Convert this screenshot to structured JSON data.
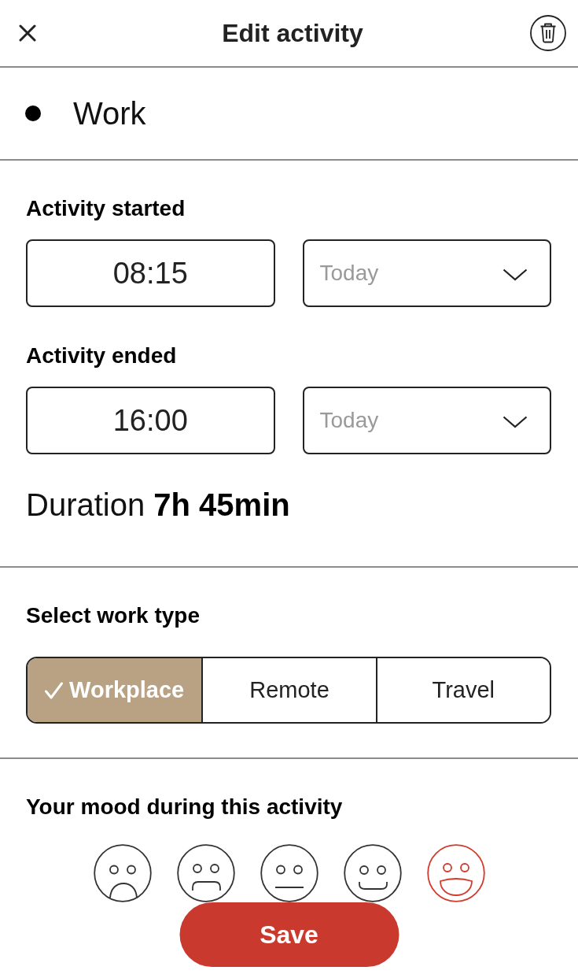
{
  "header": {
    "title": "Edit activity"
  },
  "activity": {
    "name": "Work"
  },
  "times": [
    {
      "label": "Activity started",
      "time": {
        "value": "08:15"
      },
      "day": {
        "placeholder": "Today"
      }
    },
    {
      "label": "Activity ended",
      "time": {
        "value": "16:00"
      },
      "day": {
        "placeholder": "Today"
      }
    }
  ],
  "duration": "Duration **7h 45min**",
  "work_type": {
    "label": "Select work type",
    "options": [
      {
        "label": "Workplace",
        "selected": true
      },
      {
        "label": "Remote",
        "selected": false
      },
      {
        "label": "Travel",
        "selected": false
      }
    ]
  },
  "mood": {
    "label": "Your mood during this activity",
    "options": [
      {
        "kind": "very-sad",
        "selected": false
      },
      {
        "kind": "sad",
        "selected": false
      },
      {
        "kind": "neutral",
        "selected": false
      },
      {
        "kind": "happy",
        "selected": false
      },
      {
        "kind": "very-happy",
        "selected": true
      }
    ]
  },
  "save_button": {
    "label": "Save"
  }
}
